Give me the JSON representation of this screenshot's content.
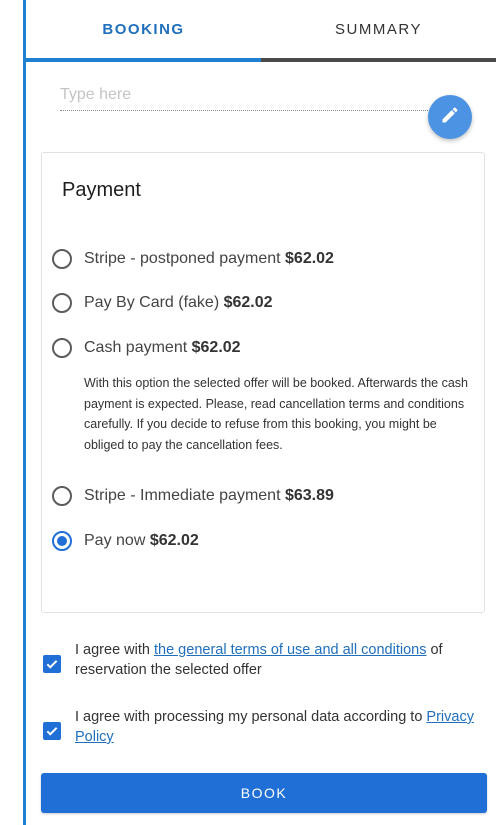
{
  "tabs": [
    {
      "label": "BOOKING",
      "active": true
    },
    {
      "label": "SUMMARY",
      "active": false
    }
  ],
  "note": {
    "placeholder": "Type here",
    "value": ""
  },
  "icons": {
    "edit": "pencil-icon",
    "check": "checkmark-icon"
  },
  "payment": {
    "title": "Payment",
    "options": [
      {
        "name": "Stripe - postponed payment",
        "price": "$62.02",
        "selected": false
      },
      {
        "name": "Pay By Card (fake)",
        "price": "$62.02",
        "selected": false
      },
      {
        "name": "Cash payment",
        "price": "$62.02",
        "selected": false
      },
      {
        "name": "Stripe - Immediate payment",
        "price": "$63.89",
        "selected": false
      },
      {
        "name": "Pay now",
        "price": "$62.02",
        "selected": true
      }
    ],
    "cash_description": "With this option the selected offer will be booked. Afterwards the cash payment is expected. Please, read cancellation terms and conditions carefully. If you decide to refuse from this booking, you might be obliged to pay the cancellation fees."
  },
  "agreements": {
    "terms": {
      "prefix": "I agree with ",
      "link": "the general terms of use and all conditions",
      "suffix": " of reservation the selected offer",
      "checked": true
    },
    "privacy": {
      "prefix": "I agree with processing my personal data according to ",
      "link": "Privacy Policy",
      "checked": true
    }
  },
  "book_label": "BOOK",
  "colors": {
    "accent": "#1f6fd6",
    "frame": "#1f7fd1",
    "fab": "#4d93e3"
  }
}
